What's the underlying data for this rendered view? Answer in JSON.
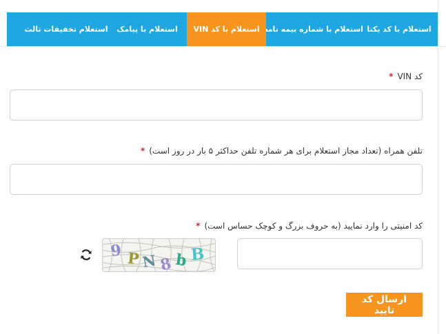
{
  "tabs": [
    {
      "label": "استعلام با کد یکتا",
      "active": false
    },
    {
      "label": "استعلام با شماره بیمه نامه",
      "active": false
    },
    {
      "label": "استعلام با کد VIN",
      "active": true
    },
    {
      "label": "استعلام با پیامک",
      "active": false
    },
    {
      "label": "استعلام تخفیفات ثالث",
      "active": false
    }
  ],
  "form": {
    "vin_label": "کد VIN",
    "vin_value": "",
    "phone_label": "تلفن همراه (تعداد مجاز استعلام برای هر شماره تلفن حداکثر ۵ بار در روز است)",
    "phone_value": "",
    "captcha_label": "کد امنیتی را وارد نمایید (به حروف بزرگ و کوچک حساس است)",
    "captcha_value": "",
    "required_mark": "*",
    "captcha_text": "9PN8bB",
    "submit_label": "ارسال کد تایید"
  },
  "colors": {
    "tab_bar": "#1ea7e1",
    "active_tab": "#f7941d",
    "required": "#e02424",
    "button": "#f7941d"
  }
}
